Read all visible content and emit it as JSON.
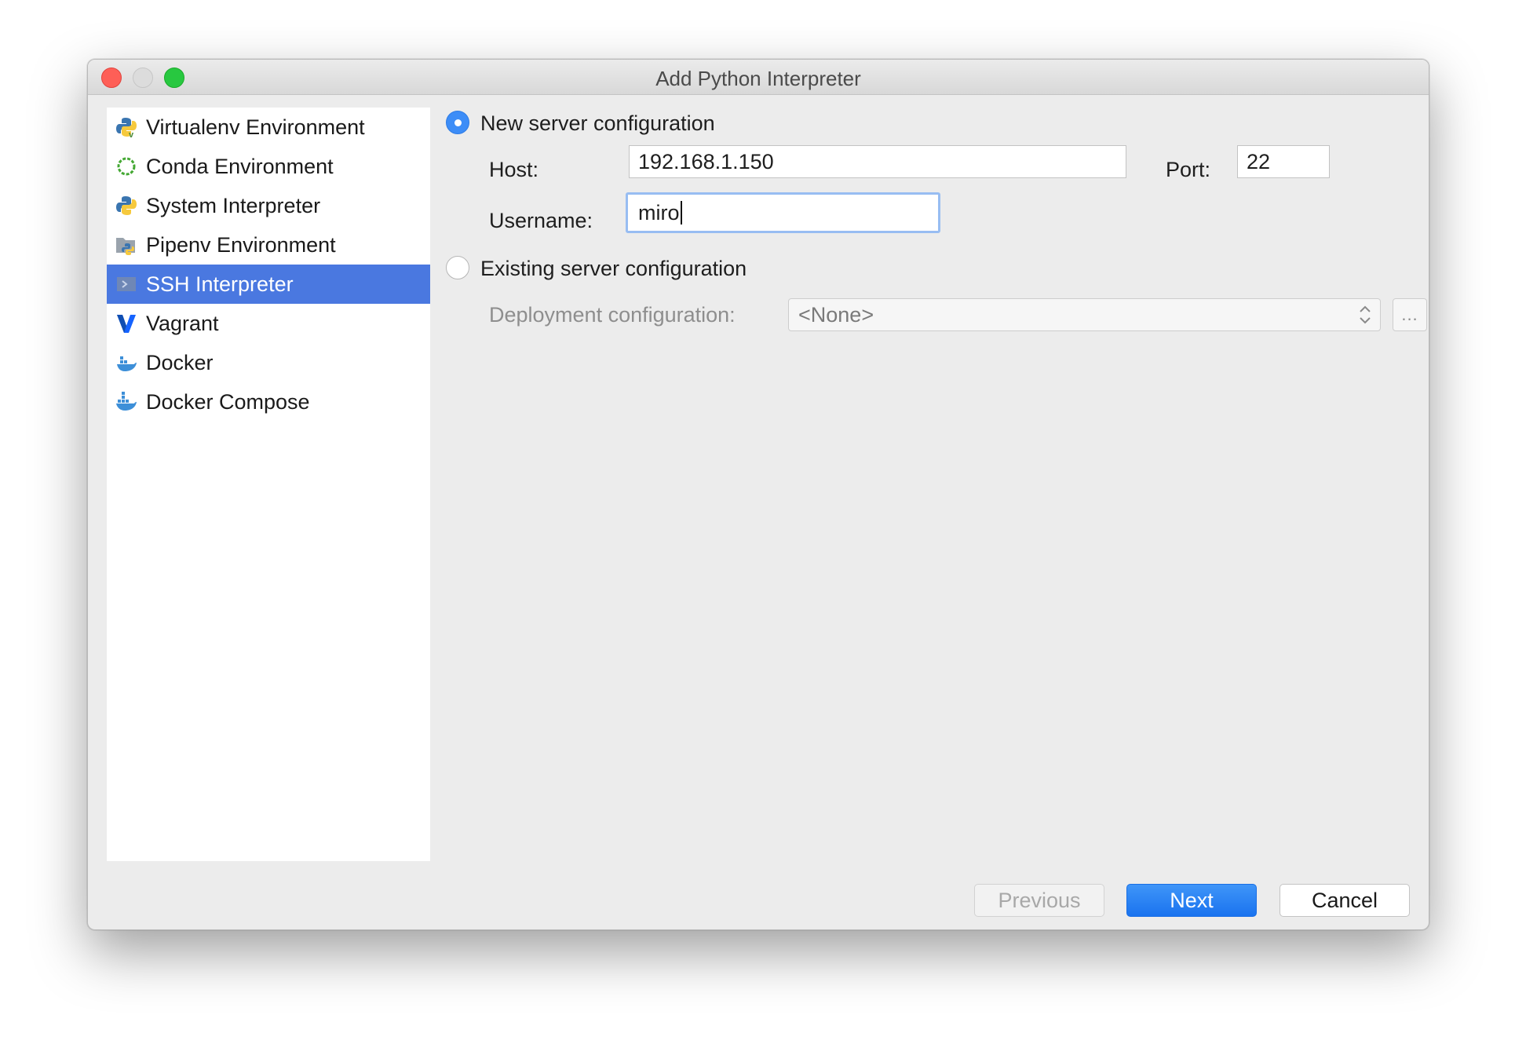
{
  "window": {
    "title": "Add Python Interpreter"
  },
  "sidebar": {
    "items": [
      {
        "label": "Virtualenv Environment",
        "icon": "python-venv-icon"
      },
      {
        "label": "Conda Environment",
        "icon": "conda-icon"
      },
      {
        "label": "System Interpreter",
        "icon": "python-icon"
      },
      {
        "label": "Pipenv Environment",
        "icon": "pipenv-icon"
      },
      {
        "label": "SSH Interpreter",
        "icon": "ssh-icon",
        "selected": true
      },
      {
        "label": "Vagrant",
        "icon": "vagrant-icon"
      },
      {
        "label": "Docker",
        "icon": "docker-icon"
      },
      {
        "label": "Docker Compose",
        "icon": "docker-compose-icon"
      }
    ]
  },
  "form": {
    "new_server_label": "New server configuration",
    "new_server_selected": true,
    "host_label": "Host:",
    "host_value": "192.168.1.150",
    "port_label": "Port:",
    "port_value": "22",
    "username_label": "Username:",
    "username_value": "miro",
    "existing_server_label": "Existing server configuration",
    "existing_server_selected": false,
    "deployment_label": "Deployment configuration:",
    "deployment_value": "<None>",
    "browse_label": "..."
  },
  "buttons": {
    "previous": "Previous",
    "next": "Next",
    "cancel": "Cancel"
  },
  "colors": {
    "selection": "#4a78e0",
    "primary_button": "#1a73ef",
    "radio_selected": "#3d8df7",
    "focus_ring": "#98bdf2"
  }
}
